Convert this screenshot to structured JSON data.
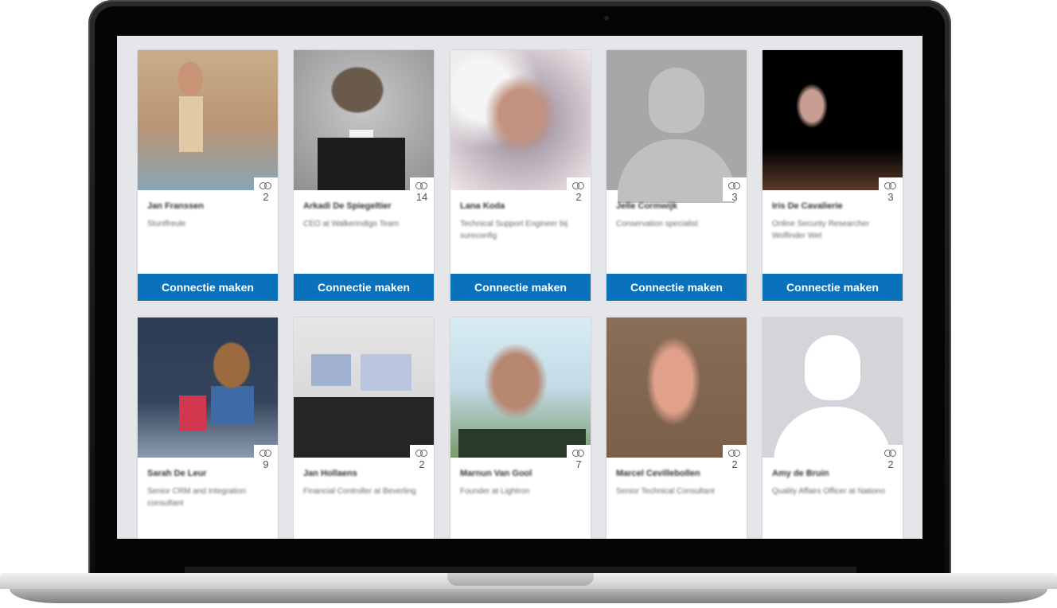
{
  "people": [
    {
      "name": "Jan Franssen",
      "headline": "Stuntfreule",
      "connections": "2",
      "button": "Connectie maken"
    },
    {
      "name": "Arkadi De Spiegeltier",
      "headline": "CEO at Walkerindigo Team",
      "connections": "14",
      "button": "Connectie maken"
    },
    {
      "name": "Lana Koda",
      "headline": "Technical Support Engineer bij sureconfig",
      "connections": "2",
      "button": "Connectie maken"
    },
    {
      "name": "Jelle Cormwijk",
      "headline": "Conservation specialist",
      "connections": "3",
      "button": "Connectie maken"
    },
    {
      "name": "Iris De Cavalierie",
      "headline": "Online Security Researcher Wolfinder Wet",
      "connections": "3",
      "button": "Connectie maken"
    },
    {
      "name": "Sarah De Leur",
      "headline": "Senior CRM and Integration consultant",
      "connections": "9",
      "button": ""
    },
    {
      "name": "Jan Hollaens",
      "headline": "Financial Controller at Beverling",
      "connections": "2",
      "button": ""
    },
    {
      "name": "Marnun Van Gool",
      "headline": "Founder at Lightron",
      "connections": "7",
      "button": ""
    },
    {
      "name": "Marcel Cevillebollen",
      "headline": "Senior Technical Consultant",
      "connections": "2",
      "button": ""
    },
    {
      "name": "Amy de Bruin",
      "headline": "Quality Affairs Officer at Nationo",
      "connections": "2",
      "button": ""
    }
  ]
}
